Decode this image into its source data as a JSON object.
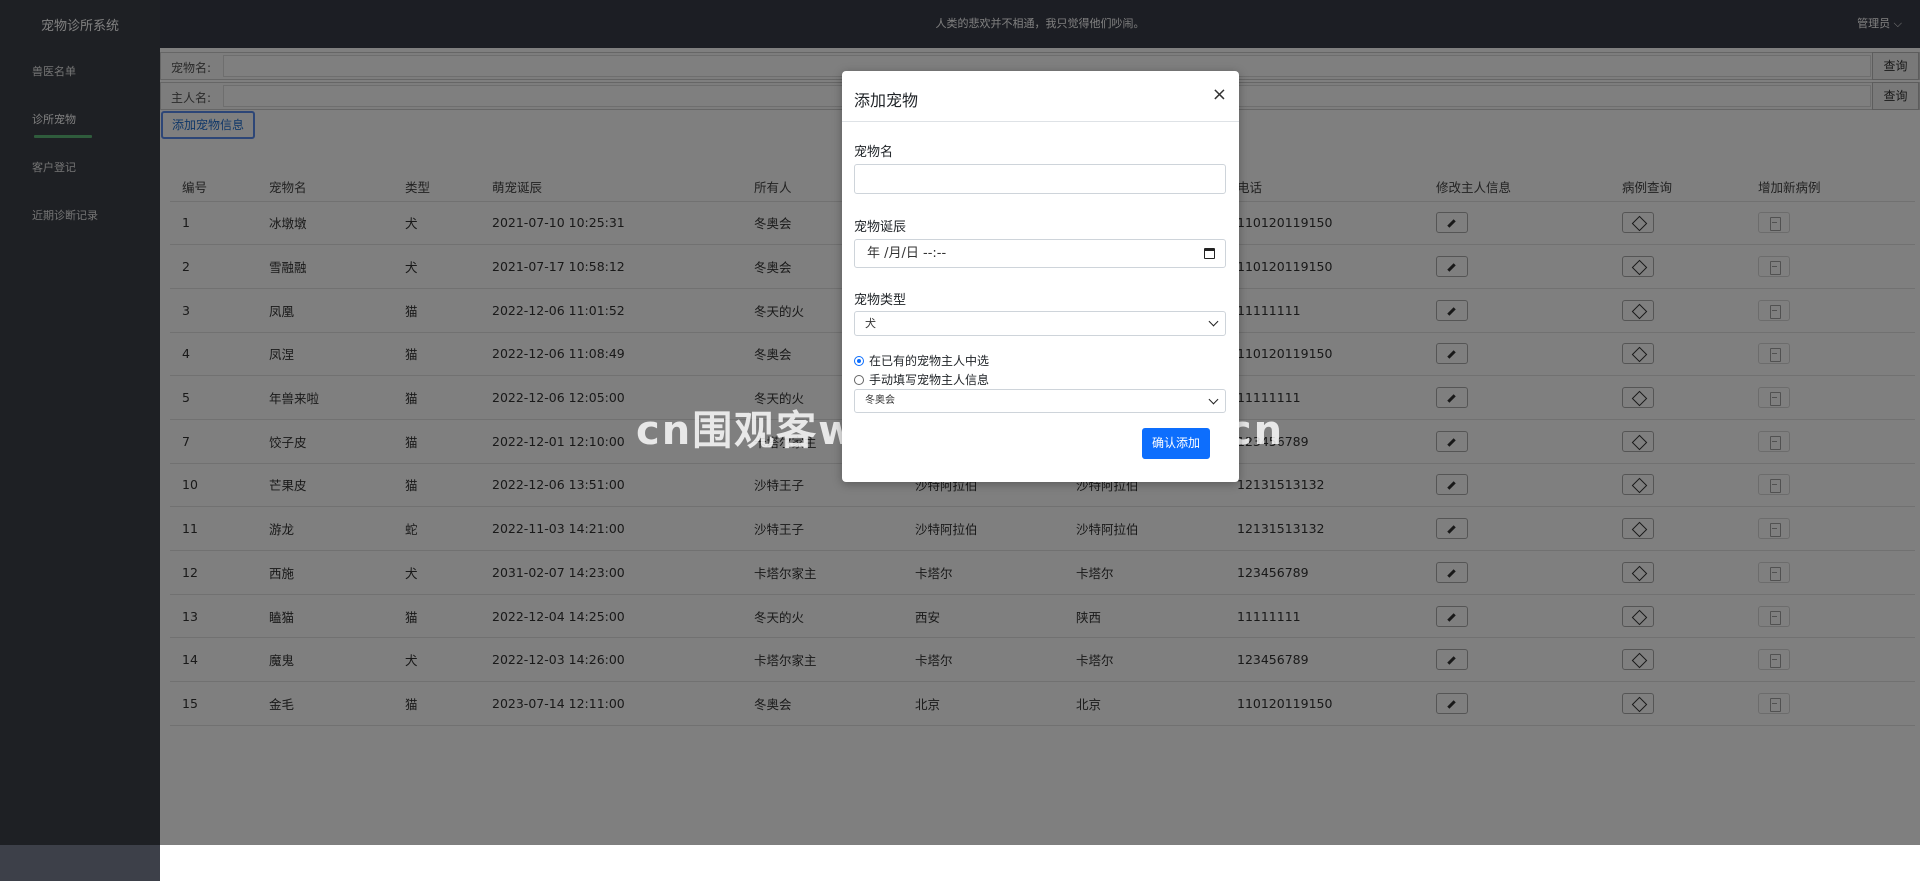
{
  "app": {
    "title": "宠物诊所系统",
    "slogan": "人类的悲欢并不相通，我只觉得他们吵闹。",
    "user": "管理员"
  },
  "sidebar": {
    "items": [
      {
        "label": "兽医名单"
      },
      {
        "label": "诊所宠物"
      },
      {
        "label": "客户登记"
      },
      {
        "label": "近期诊断记录"
      }
    ]
  },
  "search": {
    "pet_label": "宠物名:",
    "pet_query_btn": "查询",
    "owner_label": "主人名:",
    "owner_query_btn": "查询"
  },
  "add_button": "添加宠物信息",
  "table": {
    "headers": [
      "编号",
      "宠物名",
      "类型",
      "萌宠诞辰",
      "所有人",
      "",
      "",
      "电话",
      "修改主人信息",
      "病例查询",
      "增加新病例"
    ],
    "rows": [
      [
        "1",
        "冰墩墩",
        "犬",
        "2021-07-10 10:25:31",
        "冬奥会",
        "",
        "",
        "110120119150"
      ],
      [
        "2",
        "雪融融",
        "犬",
        "2021-07-17 10:58:12",
        "冬奥会",
        "",
        "",
        "110120119150"
      ],
      [
        "3",
        "凤凰",
        "猫",
        "2022-12-06 11:01:52",
        "冬天的火",
        "",
        "",
        "11111111"
      ],
      [
        "4",
        "凤涅",
        "猫",
        "2022-12-06 11:08:49",
        "冬奥会",
        "",
        "",
        "110120119150"
      ],
      [
        "5",
        "年兽来啦",
        "猫",
        "2022-12-06 12:05:00",
        "冬天的火",
        "",
        "",
        "11111111"
      ],
      [
        "7",
        "饺子皮",
        "猫",
        "2022-12-01 12:10:00",
        "卡塔尔家主",
        "",
        "",
        "123456789"
      ],
      [
        "10",
        "芒果皮",
        "猫",
        "2022-12-06 13:51:00",
        "沙特王子",
        "沙特阿拉伯",
        "沙特阿拉伯",
        "12131513132"
      ],
      [
        "11",
        "游龙",
        "蛇",
        "2022-11-03 14:21:00",
        "沙特王子",
        "沙特阿拉伯",
        "沙特阿拉伯",
        "12131513132"
      ],
      [
        "12",
        "西施",
        "犬",
        "2031-02-07 14:23:00",
        "卡塔尔家主",
        "卡塔尔",
        "卡塔尔",
        "123456789"
      ],
      [
        "13",
        "瞌猫",
        "猫",
        "2022-12-04 14:25:00",
        "冬天的火",
        "西安",
        "陕西",
        "11111111"
      ],
      [
        "14",
        "魔鬼",
        "犬",
        "2022-12-03 14:26:00",
        "卡塔尔家主",
        "卡塔尔",
        "卡塔尔",
        "123456789"
      ],
      [
        "15",
        "金毛",
        "猫",
        "2023-07-14 12:11:00",
        "冬奥会",
        "北京",
        "北京",
        "110120119150"
      ]
    ]
  },
  "modal": {
    "title": "添加宠物",
    "close": "×",
    "pet_name_label": "宠物名",
    "birthday_label": "宠物诞辰",
    "birthday_placeholder": "年 /月/日 --:--",
    "type_label": "宠物类型",
    "type_value": "犬",
    "radio_existing": "在已有的宠物主人中选",
    "radio_manual": "手动填写宠物主人信息",
    "owner_value": "冬奥会",
    "confirm": "确认添加"
  },
  "watermark": "cn围观客www.weiguanke.cn",
  "icons": [
    "pencil-icon",
    "cube-icon",
    "clipboard-icon",
    "calendar-icon",
    "chevron-down-icon",
    "close-icon"
  ],
  "colors": {
    "sidebar": "#3d4049",
    "topbar": "#393d49",
    "active_underline": "#5fb878",
    "primary": "#0d6efd"
  }
}
